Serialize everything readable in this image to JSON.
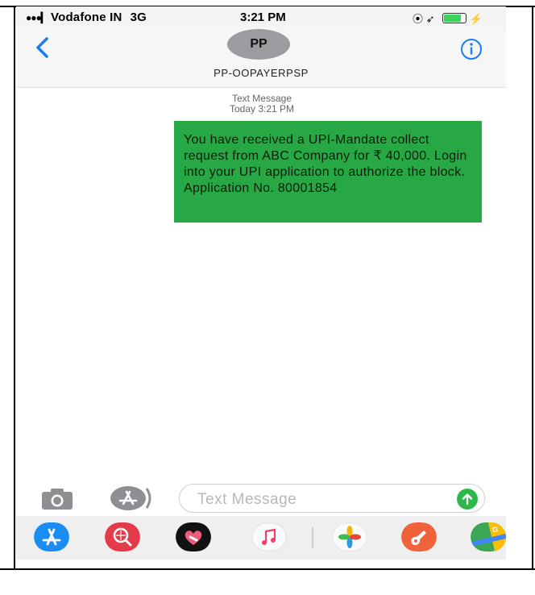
{
  "status_bar": {
    "signal": "●●●▎",
    "carrier": "Vodafone IN",
    "network": "3G",
    "time": "3:21 PM",
    "right_icons": "⦿  ➶",
    "battery_level": 0.8
  },
  "header": {
    "avatar_initials": "PP",
    "contact_name": "PP-OOPAYERPSP"
  },
  "thread": {
    "meta_label": "Text Message",
    "meta_time": "Today 3:21 PM",
    "message": "You have received a UPI-Mandate collect request from ABC Company for ₹ 40,000. Login into your UPI application to authorize the block. Application No. 80001854"
  },
  "compose": {
    "placeholder": "Text Message"
  },
  "colors": {
    "accent": "#1a7cf5",
    "bubble": "#27a844",
    "send": "#2fb84a"
  },
  "app_tray": [
    {
      "name": "app-store-icon"
    },
    {
      "name": "search-images-icon"
    },
    {
      "name": "digital-touch-icon"
    },
    {
      "name": "music-icon"
    },
    {
      "name": "photos-icon"
    },
    {
      "name": "garageband-icon"
    },
    {
      "name": "maps-icon"
    }
  ]
}
